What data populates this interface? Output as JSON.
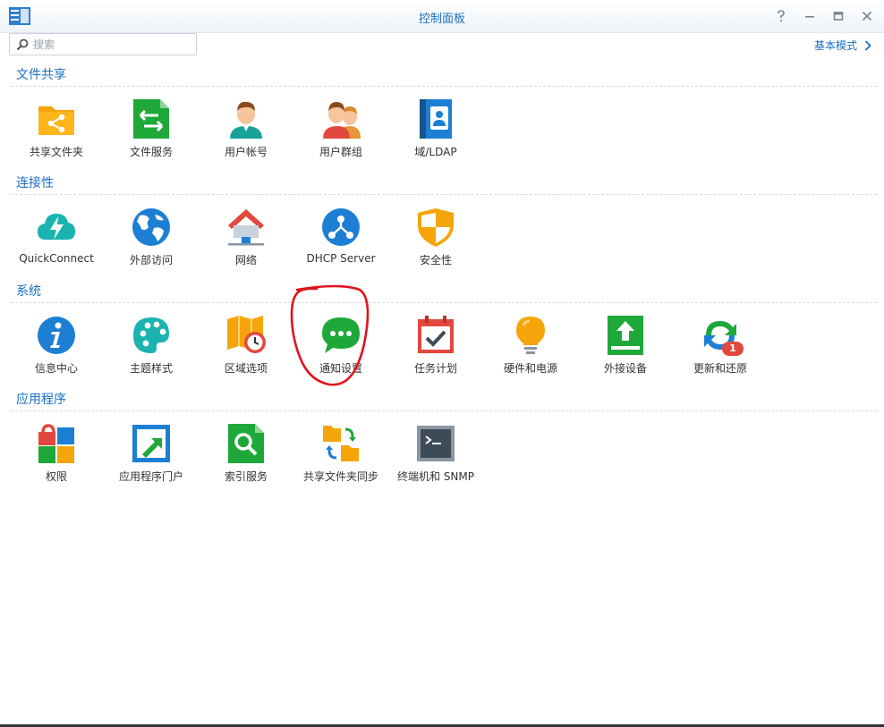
{
  "window": {
    "title": "控制面板"
  },
  "search": {
    "placeholder": "搜索",
    "value": ""
  },
  "mode_label": "基本模式",
  "sections": [
    {
      "title": "文件共享",
      "items": [
        "共享文件夹",
        "文件服务",
        "用户帐号",
        "用户群组",
        "域/LDAP"
      ]
    },
    {
      "title": "连接性",
      "items": [
        "QuickConnect",
        "外部访问",
        "网络",
        "DHCP Server",
        "安全性"
      ]
    },
    {
      "title": "系统",
      "items": [
        "信息中心",
        "主题样式",
        "区域选项",
        "通知设置",
        "任务计划",
        "硬件和电源",
        "外接设备",
        "更新和还原"
      ]
    },
    {
      "title": "应用程序",
      "items": [
        "权限",
        "应用程序门户",
        "索引服务",
        "共享文件夹同步",
        "终端机和 SNMP"
      ]
    }
  ],
  "badges": {
    "update_count": "1"
  },
  "colors": {
    "accent": "#1a6fc2",
    "annotation": "#e0131b"
  }
}
